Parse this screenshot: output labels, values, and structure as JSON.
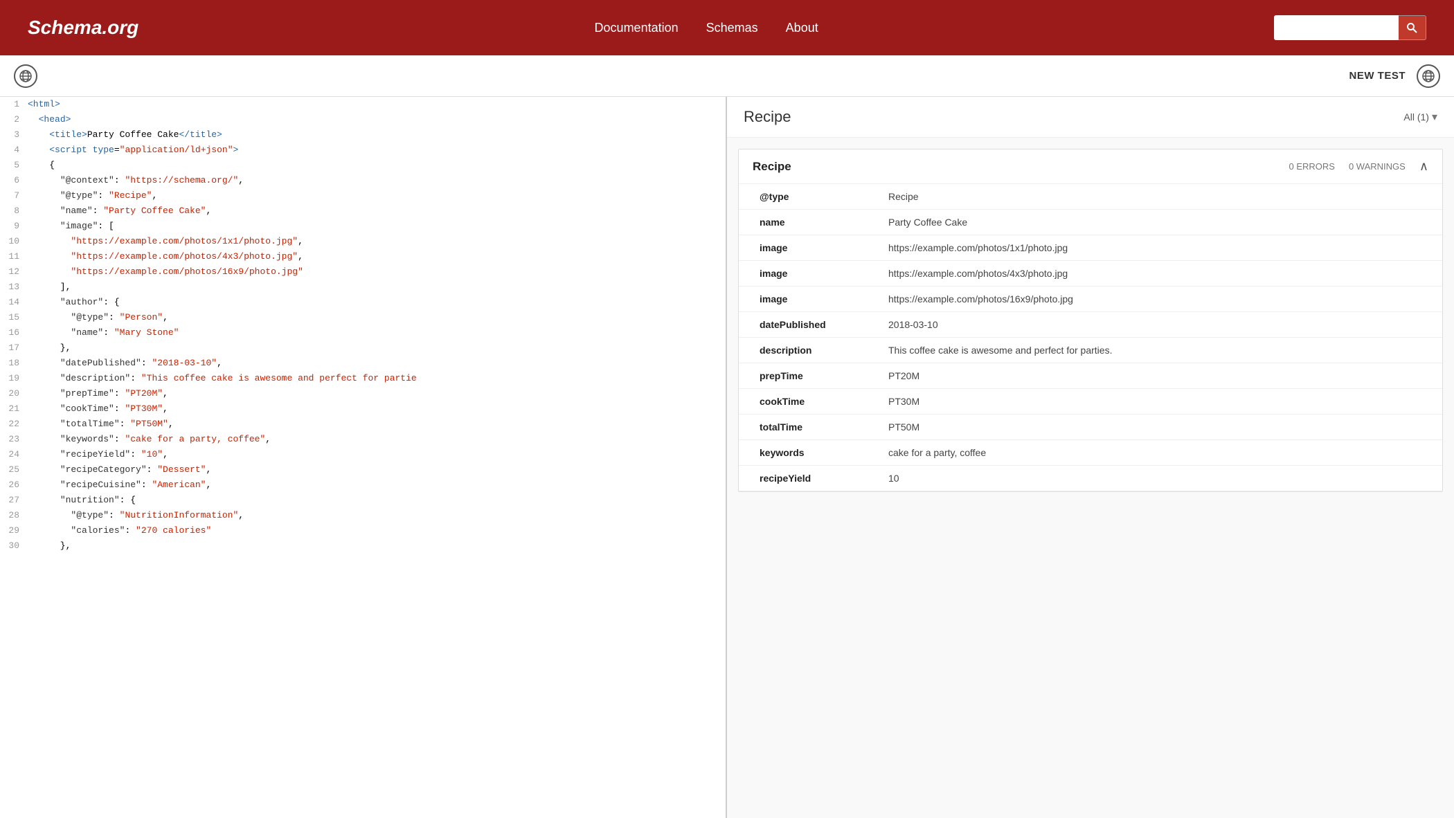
{
  "header": {
    "logo": "Schema.org",
    "nav": {
      "documentation": "Documentation",
      "schemas": "Schemas",
      "about": "About"
    },
    "search_placeholder": ""
  },
  "toolbar": {
    "new_test_label": "NEW TEST"
  },
  "code_editor": {
    "lines": [
      {
        "num": 1,
        "html": "<span class='c-tag'>&lt;html&gt;</span>"
      },
      {
        "num": 2,
        "html": "  <span class='c-tag'>&lt;head&gt;</span>"
      },
      {
        "num": 3,
        "html": "    <span class='c-tag'>&lt;title&gt;</span>Party Coffee Cake<span class='c-tag'>&lt;/title&gt;</span>"
      },
      {
        "num": 4,
        "html": "    <span class='c-tag'>&lt;script</span> <span class='c-attr'>type</span>=<span class='c-string'>\"application/ld+json\"</span><span class='c-tag'>&gt;</span>"
      },
      {
        "num": 5,
        "html": "    {"
      },
      {
        "num": 6,
        "html": "      <span class='c-key'>\"@context\"</span>: <span class='c-string'>\"https://schema.org/\"</span>,"
      },
      {
        "num": 7,
        "html": "      <span class='c-key'>\"@type\"</span>: <span class='c-string'>\"Recipe\"</span>,"
      },
      {
        "num": 8,
        "html": "      <span class='c-key'>\"name\"</span>: <span class='c-string'>\"Party Coffee Cake\"</span>,"
      },
      {
        "num": 9,
        "html": "      <span class='c-key'>\"image\"</span>: ["
      },
      {
        "num": 10,
        "html": "        <span class='c-string'>\"https://example.com/photos/1x1/photo.jpg\"</span>,"
      },
      {
        "num": 11,
        "html": "        <span class='c-string'>\"https://example.com/photos/4x3/photo.jpg\"</span>,"
      },
      {
        "num": 12,
        "html": "        <span class='c-string'>\"https://example.com/photos/16x9/photo.jpg\"</span>"
      },
      {
        "num": 13,
        "html": "      ],"
      },
      {
        "num": 14,
        "html": "      <span class='c-key'>\"author\"</span>: {"
      },
      {
        "num": 15,
        "html": "        <span class='c-key'>\"@type\"</span>: <span class='c-string'>\"Person\"</span>,"
      },
      {
        "num": 16,
        "html": "        <span class='c-key'>\"name\"</span>: <span class='c-string'>\"Mary Stone\"</span>"
      },
      {
        "num": 17,
        "html": "      },"
      },
      {
        "num": 18,
        "html": "      <span class='c-key'>\"datePublished\"</span>: <span class='c-string'>\"2018-03-10\"</span>,"
      },
      {
        "num": 19,
        "html": "      <span class='c-key'>\"description\"</span>: <span class='c-string'>\"This coffee cake is awesome and perfect for partie</span>"
      },
      {
        "num": 20,
        "html": "      <span class='c-key'>\"prepTime\"</span>: <span class='c-string'>\"PT20M\"</span>,"
      },
      {
        "num": 21,
        "html": "      <span class='c-key'>\"cookTime\"</span>: <span class='c-string'>\"PT30M\"</span>,"
      },
      {
        "num": 22,
        "html": "      <span class='c-key'>\"totalTime\"</span>: <span class='c-string'>\"PT50M\"</span>,"
      },
      {
        "num": 23,
        "html": "      <span class='c-key'>\"keywords\"</span>: <span class='c-string'>\"cake for a party, coffee\"</span>,"
      },
      {
        "num": 24,
        "html": "      <span class='c-key'>\"recipeYield\"</span>: <span class='c-string'>\"10\"</span>,"
      },
      {
        "num": 25,
        "html": "      <span class='c-key'>\"recipeCategory\"</span>: <span class='c-string'>\"Dessert\"</span>,"
      },
      {
        "num": 26,
        "html": "      <span class='c-key'>\"recipeCuisine\"</span>: <span class='c-string'>\"American\"</span>,"
      },
      {
        "num": 27,
        "html": "      <span class='c-key'>\"nutrition\"</span>: {"
      },
      {
        "num": 28,
        "html": "        <span class='c-key'>\"@type\"</span>: <span class='c-string'>\"NutritionInformation\"</span>,"
      },
      {
        "num": 29,
        "html": "        <span class='c-key'>\"calories\"</span>: <span class='c-string'>\"270 calories\"</span>"
      },
      {
        "num": 30,
        "html": "      },"
      }
    ]
  },
  "results": {
    "title": "Recipe",
    "filter_label": "All (1)",
    "recipe_card": {
      "title": "Recipe",
      "errors": "0 ERRORS",
      "warnings": "0 WARNINGS",
      "fields": [
        {
          "key": "@type",
          "value": "Recipe"
        },
        {
          "key": "name",
          "value": "Party Coffee Cake"
        },
        {
          "key": "image",
          "value": "https://example.com/photos/1x1/photo.jpg"
        },
        {
          "key": "image",
          "value": "https://example.com/photos/4x3/photo.jpg"
        },
        {
          "key": "image",
          "value": "https://example.com/photos/16x9/photo.jpg"
        },
        {
          "key": "datePublished",
          "value": "2018-03-10"
        },
        {
          "key": "description",
          "value": "This coffee cake is awesome and perfect for parties."
        },
        {
          "key": "prepTime",
          "value": "PT20M"
        },
        {
          "key": "cookTime",
          "value": "PT30M"
        },
        {
          "key": "totalTime",
          "value": "PT50M"
        },
        {
          "key": "keywords",
          "value": "cake for a party, coffee"
        },
        {
          "key": "recipeYield",
          "value": "10"
        }
      ]
    }
  }
}
